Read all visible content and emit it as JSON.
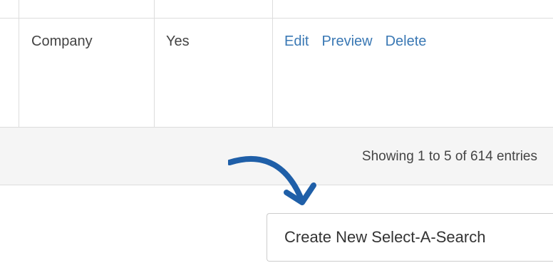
{
  "table": {
    "row": {
      "type": "Company",
      "active": "Yes",
      "actions": {
        "edit": "Edit",
        "preview": "Preview",
        "delete": "Delete"
      }
    }
  },
  "info": {
    "text": "Showing 1 to 5 of 614 entries"
  },
  "create_button": {
    "label": "Create New Select-A-Search"
  },
  "colors": {
    "link": "#3a78b4",
    "arrow": "#1f5fa8",
    "border": "#dddddd",
    "footer_bg": "#f5f5f5"
  }
}
